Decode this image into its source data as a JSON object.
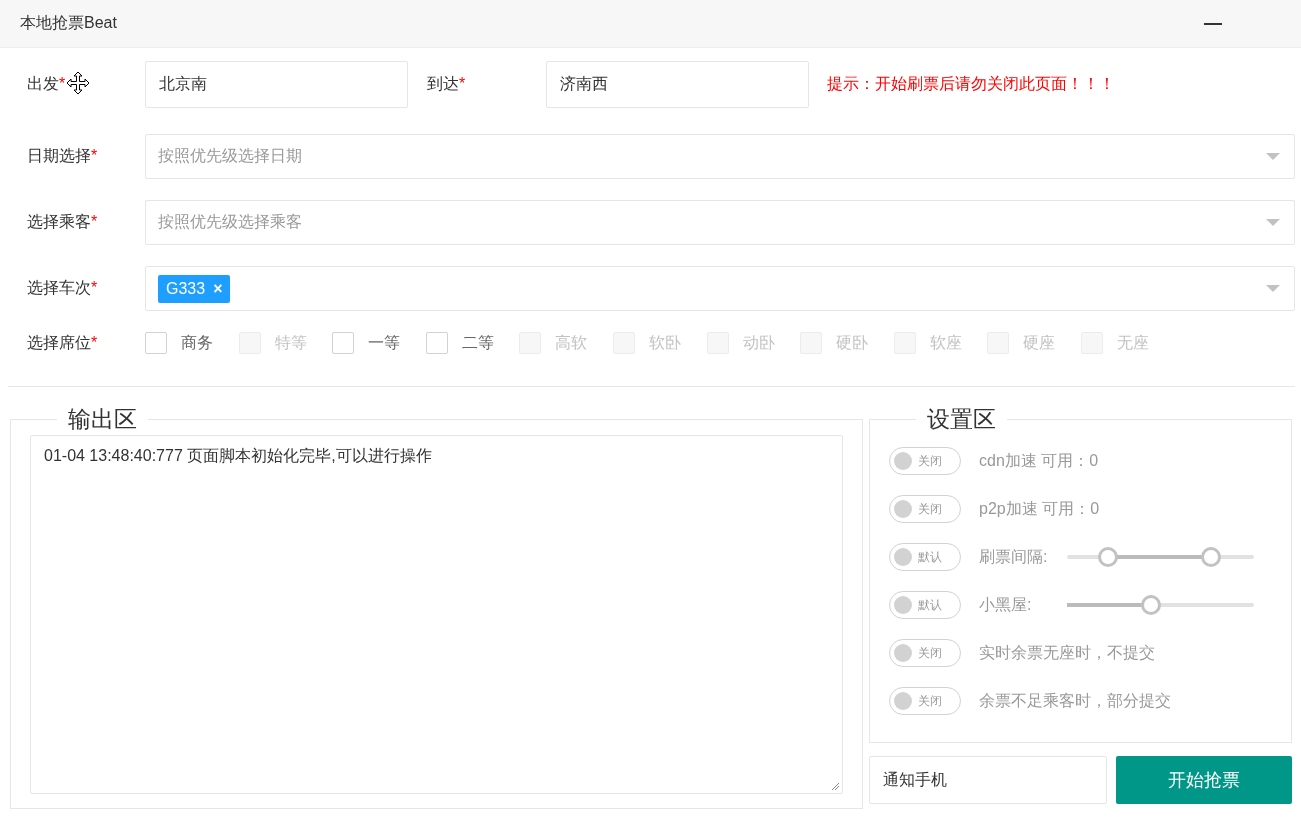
{
  "window": {
    "title": "本地抢票Beat"
  },
  "route": {
    "from": {
      "label": "出发",
      "required_mark": "*",
      "value": "北京南"
    },
    "to": {
      "label": "到达",
      "required_mark": "*",
      "value": "济南西"
    },
    "hint": "提示：开始刷票后请勿关闭此页面！！！"
  },
  "selects": [
    {
      "label": "日期选择",
      "required_mark": "*",
      "placeholder": "按照优先级选择日期"
    },
    {
      "label": "选择乘客",
      "required_mark": "*",
      "placeholder": "按照优先级选择乘客"
    },
    {
      "label": "选择车次",
      "required_mark": "*",
      "tags": [
        {
          "label": "G333",
          "remove": "×"
        }
      ]
    }
  ],
  "seats": {
    "label": "选择席位",
    "required_mark": "*",
    "options": [
      {
        "label": "商务",
        "checked": false,
        "disabled": false
      },
      {
        "label": "特等",
        "checked": false,
        "disabled": true
      },
      {
        "label": "一等",
        "checked": false,
        "disabled": false
      },
      {
        "label": "二等",
        "checked": false,
        "disabled": false
      },
      {
        "label": "高软",
        "checked": false,
        "disabled": true
      },
      {
        "label": "软卧",
        "checked": false,
        "disabled": true
      },
      {
        "label": "动卧",
        "checked": false,
        "disabled": true
      },
      {
        "label": "硬卧",
        "checked": false,
        "disabled": true
      },
      {
        "label": "软座",
        "checked": false,
        "disabled": true
      },
      {
        "label": "硬座",
        "checked": false,
        "disabled": true
      },
      {
        "label": "无座",
        "checked": false,
        "disabled": true
      }
    ]
  },
  "output": {
    "legend": "输出区",
    "log": "01-04 13:48:40:777 页面脚本初始化完毕,可以进行操作"
  },
  "settings": {
    "legend": "设置区",
    "items": [
      {
        "kind": "toggle",
        "switch_label": "关闭",
        "on": false,
        "text": "cdn加速 可用：0"
      },
      {
        "kind": "toggle",
        "switch_label": "关闭",
        "on": false,
        "text": "p2p加速 可用：0"
      },
      {
        "kind": "range",
        "switch_label": "默认",
        "on": false,
        "text": "刷票间隔:",
        "thumbs": [
          {
            "level": 0.22
          },
          {
            "level": 0.77
          }
        ]
      },
      {
        "kind": "slider",
        "switch_label": "默认",
        "on": false,
        "text": "小黑屋:",
        "level": 0.45
      },
      {
        "kind": "toggle",
        "switch_label": "关闭",
        "on": false,
        "text": "实时余票无座时，不提交"
      },
      {
        "kind": "toggle",
        "switch_label": "关闭",
        "on": false,
        "text": "余票不足乘客时，部分提交"
      }
    ]
  },
  "notify": {
    "placeholder": "通知手机"
  },
  "start_button": "开始抢票"
}
